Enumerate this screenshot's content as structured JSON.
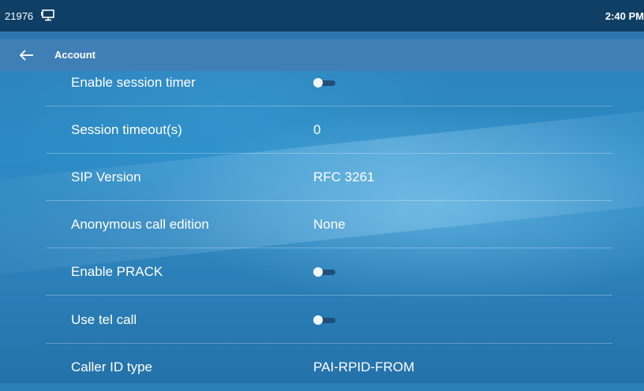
{
  "status_bar": {
    "extension": "21976",
    "icon": "network-monitor-icon",
    "time": "2:40 PM"
  },
  "app_bar": {
    "back_icon": "back-arrow-icon",
    "title": "Account"
  },
  "settings": [
    {
      "label": "Enable session timer",
      "type": "toggle",
      "on": false
    },
    {
      "label": "Session timeout(s)",
      "type": "value",
      "value": "0"
    },
    {
      "label": "SIP Version",
      "type": "value",
      "value": "RFC 3261"
    },
    {
      "label": "Anonymous call edition",
      "type": "value",
      "value": "None"
    },
    {
      "label": "Enable PRACK",
      "type": "toggle",
      "on": false
    },
    {
      "label": "Use tel call",
      "type": "toggle",
      "on": false
    },
    {
      "label": "Caller ID type",
      "type": "value",
      "value": "PAI-RPID-FROM"
    }
  ],
  "colors": {
    "status_bar_bg": "#0f3f64",
    "app_bar_bg": "#3f7fb6",
    "background": "#2a7fb8",
    "text": "#ffffff"
  }
}
